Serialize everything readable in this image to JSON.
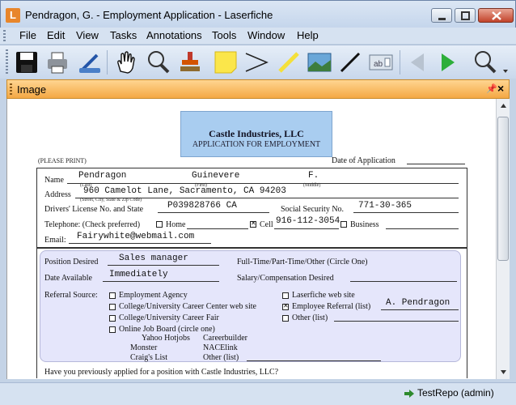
{
  "window": {
    "title": "Pendragon, G. - Employment Application - Laserfiche",
    "app_icon_letter": "L"
  },
  "menu": [
    "File",
    "Edit",
    "View",
    "Tasks",
    "Annotations",
    "Tools",
    "Window",
    "Help"
  ],
  "toolbar": {
    "icons": [
      "save-icon",
      "print-icon",
      "scanner-icon",
      "hand-icon",
      "zoom-icon",
      "stamp-icon",
      "sticky-note-icon",
      "callout-icon",
      "highlighter-icon",
      "image-icon",
      "pen-icon",
      "text-box-icon",
      "previous-page-icon",
      "next-page-icon",
      "zoom-in-icon"
    ]
  },
  "panel": {
    "title": "Image"
  },
  "form": {
    "company": "Castle Industries, LLC",
    "subtitle": "APPLICATION FOR EMPLOYMENT",
    "please_print": "(PLEASE PRINT)",
    "date_of_application": "Date of Application",
    "name_label": "Name",
    "last_name": "Pendragon",
    "first_name": "Guinevere",
    "middle_initial": "F.",
    "hint_last": "(Last)",
    "hint_first": "(First)",
    "hint_middle": "(Middle)",
    "address_label": "Address",
    "address": "960 Camelot Lane, Sacramento, CA 94203",
    "hint_address": "(Street, City, State & Zip Code)",
    "license_label": "Drivers' License No. and State",
    "license": "P039828766 CA",
    "ssn_label": "Social Security No.",
    "ssn": "771-30-365",
    "telephone_label": "Telephone: (Check preferred)",
    "home_label": "Home",
    "cell_label": "Cell",
    "cell_number": "916-112-3054",
    "business_label": "Business",
    "email_label": "Email:",
    "email": "Fairywhite@webmail.com",
    "position_label": "Position Desired",
    "position": "Sales manager",
    "fulltime_label": "Full-Time/Part-Time/Other (Circle One)",
    "date_available_label": "Date Available",
    "date_available": "Immediately",
    "salary_label": "Salary/Compensation Desired",
    "referral_label": "Referral Source:",
    "referral_left": [
      "Employment Agency",
      "College/University Career Center web site",
      "College/University Career Fair",
      "Online Job Board (circle one)"
    ],
    "referral_right": [
      "Laserfiche web site",
      "Employee Referral (list)",
      "Other (list)"
    ],
    "referral_person": "A. Pendragon",
    "job_boards": [
      "Yahoo Hotjobs",
      "Careerbuilder",
      "Monster",
      "NACElink",
      "Craig's List",
      "Other (list)"
    ],
    "previously_applied": "Have you previously applied for a position with Castle Industries, LLC?"
  },
  "status": {
    "text": "TestRepo (admin)"
  }
}
